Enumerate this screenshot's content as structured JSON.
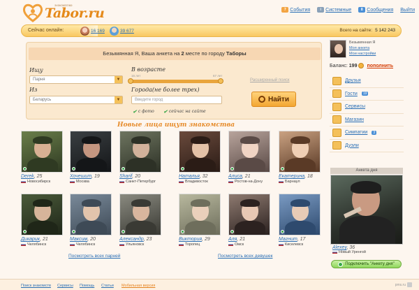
{
  "header": {
    "brand": "Tabor.ru",
    "tagline": "знакомства",
    "nav": [
      {
        "label": "События",
        "icon": "events-icon",
        "badge": "7"
      },
      {
        "label": "Системные",
        "icon": "system-icon",
        "badge": ""
      },
      {
        "label": "Сообщения",
        "icon": "messages-icon",
        "badge": "8"
      },
      {
        "label": "Выйти",
        "icon": "",
        "badge": ""
      }
    ]
  },
  "online_bar": {
    "label": "Сейчас онлайн:",
    "female_count": "16 169",
    "male_count": "39 677",
    "total_label": "Всего на сайте:",
    "total_value": "5 142 243"
  },
  "search": {
    "promo_prefix": "Безымянная Я, Ваша анкета на ",
    "promo_rank": "2",
    "promo_middle": " месте по городу ",
    "promo_city": "Таборы",
    "seek_label": "Ищу",
    "seek_value": "Парня",
    "from_label": "Из",
    "from_value": "Беларусь",
    "age_label": "В возрасте",
    "age_min": "16 лет",
    "age_max": "67 лет",
    "age_range_fraction": [
      0.0,
      1.0
    ],
    "cities_label": "Города(не более трех)",
    "cities_placeholder": "Введите город",
    "with_photo": "с фото",
    "online_now": "сейчас на сайте",
    "advanced": "Расширенный поиск",
    "find_button": "Найти"
  },
  "new_faces_title": "Новые лица ищут знакомства",
  "row1": [
    {
      "name": "Derek",
      "age": "25",
      "city": "Новосибирск"
    },
    {
      "name": "Хочешит",
      "age": "19",
      "city": "Москва"
    },
    {
      "name": "Sharif",
      "age": "20",
      "city": "Санкт-Петербург"
    },
    {
      "name": "Наталья",
      "age": "32",
      "city": "Владивосток"
    },
    {
      "name": "Алиса",
      "age": "21",
      "city": "Ростов-на-Дону"
    },
    {
      "name": "Екатерина",
      "age": "18",
      "city": "Барнаул"
    }
  ],
  "row2": [
    {
      "name": "Дикарик",
      "age": "21",
      "city": "Челябинск"
    },
    {
      "name": "Максим",
      "age": "20",
      "city": "Челябинск"
    },
    {
      "name": "Александр",
      "age": "23",
      "city": "Ульяновск"
    },
    {
      "name": "Виктория",
      "age": "29",
      "city": "Торопец"
    },
    {
      "name": "Аля",
      "age": "21",
      "city": "Омск"
    },
    {
      "name": "Магнит",
      "age": "17",
      "city": "Киселевск"
    }
  ],
  "view_all_guys": "Посмотреть всех парней",
  "view_all_girls": "Посмотреть всех девушек",
  "profile": {
    "name": "Безымянная Я",
    "link1": "Моя анкета",
    "link2": "Мои настройки",
    "balance_label": "Баланс:",
    "balance_value": "199",
    "topup": "пополнить"
  },
  "menu": [
    {
      "label": "Друзья",
      "badge": ""
    },
    {
      "label": "Гости",
      "badge": "19"
    },
    {
      "label": "Сервисы",
      "badge": ""
    },
    {
      "label": "Магазин",
      "badge": ""
    },
    {
      "label": "Симпатии",
      "badge": "3"
    },
    {
      "label": "Дуэли",
      "badge": ""
    }
  ],
  "anketa": {
    "title": "Анкета дня",
    "name": "Alexey",
    "age": "36",
    "city": "Новый Уренгой",
    "connect": "Подключить \"Анкету дня\""
  },
  "footer": {
    "links": [
      "Поиск знакомств",
      "Сервисы",
      "Помощь",
      "Статьи",
      "Мобильная версия"
    ],
    "right": "pms.ru"
  }
}
